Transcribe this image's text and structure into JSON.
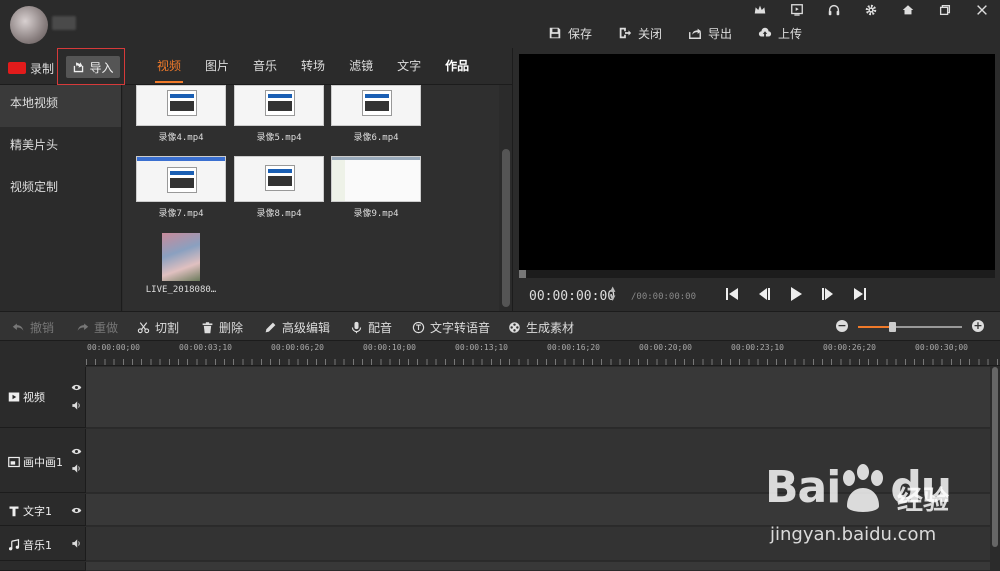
{
  "titlebar": {
    "actions": [
      {
        "label": "保存",
        "icon": "save-icon"
      },
      {
        "label": "关闭",
        "icon": "exit-icon"
      },
      {
        "label": "导出",
        "icon": "export-icon"
      },
      {
        "label": "上传",
        "icon": "upload-cloud-icon"
      }
    ],
    "window_icons": [
      "vip-crown-icon",
      "play-screen-icon",
      "headset-icon",
      "gear-icon",
      "home-icon",
      "restore-icon",
      "close-icon"
    ]
  },
  "media": {
    "record_label": "录制",
    "import_label": "导入",
    "tabs": [
      "视频",
      "图片",
      "音乐",
      "转场",
      "滤镜",
      "文字",
      "作品"
    ],
    "active_tab": "视频",
    "sidebar": [
      "本地视频",
      "精美片头",
      "视频定制"
    ],
    "files": [
      "录像4.mp4",
      "录像5.mp4",
      "录像6.mp4",
      "录像7.mp4",
      "录像8.mp4",
      "录像9.mp4",
      "LIVE_2018080…"
    ]
  },
  "preview": {
    "timecode": "00:00:00:00",
    "duration": "/00:00:00:00"
  },
  "edit_toolbar": {
    "undo": "撤销",
    "redo": "重做",
    "cut": "切割",
    "delete": "删除",
    "advanced": "高级编辑",
    "dub": "配音",
    "tts": "文字转语音",
    "generate": "生成素材",
    "zoom_level": 0.33
  },
  "timeline": {
    "ticks": [
      "00:00:00;00",
      "00:00:03;10",
      "00:00:06;20",
      "00:00:10;00",
      "00:00:13;10",
      "00:00:16;20",
      "00:00:20;00",
      "00:00:23;10",
      "00:00:26;20",
      "00:00:30;00"
    ],
    "tracks": [
      {
        "label": "视频",
        "icon": "video-track-icon"
      },
      {
        "label": "画中画1",
        "icon": "pip-icon"
      },
      {
        "label": "文字1",
        "icon": "text-icon"
      },
      {
        "label": "音乐1",
        "icon": "music-note-icon"
      }
    ]
  },
  "watermark": {
    "logo": "Bai",
    "logo_tail": "du",
    "chinese": "经验",
    "url": "jingyan.baidu.com"
  }
}
